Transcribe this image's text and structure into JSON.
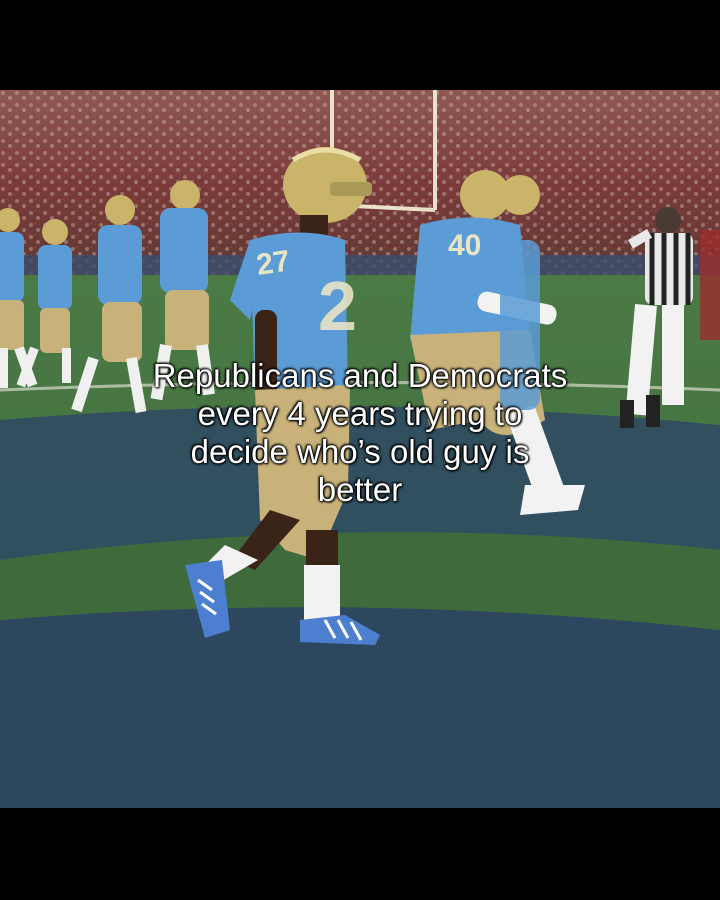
{
  "caption": {
    "lines": [
      "Republicans and Democrats",
      "every 4 years trying to",
      "decide who’s old guy is",
      "better"
    ]
  },
  "jersey_numbers": {
    "front_player": "27",
    "right_player": "40"
  },
  "colors": {
    "letterbox": "#000000",
    "crowd": "#7a3b3a",
    "field_green": "#3f6e3d",
    "field_blue": "#2f4b63",
    "jersey_blue": "#5b9bd6",
    "helmet_gold": "#c9b46a",
    "pants_gold": "#c8b27a"
  }
}
